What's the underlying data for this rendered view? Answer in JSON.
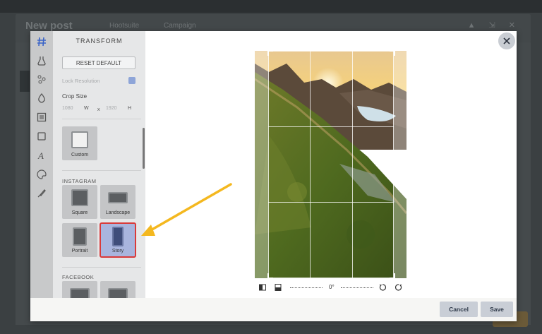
{
  "background": {
    "page_title": "New post",
    "menu_1": "Hootsuite",
    "menu_2": "Campaign"
  },
  "editor": {
    "panel_title": "TRANSFORM",
    "reset_label": "RESET DEFAULT",
    "lock_label": "Lock Resolution",
    "crop_size_label": "Crop Size",
    "width_value": "1080",
    "width_unit": "W",
    "times": "x",
    "height_value": "1920",
    "height_unit": "H",
    "custom_label": "Custom",
    "instagram_heading": "INSTAGRAM",
    "square_label": "Square",
    "landscape_label": "Landscape",
    "portrait_label": "Portrait",
    "story_label": "Story",
    "facebook_heading": "FACEBOOK",
    "rotation_value": "0°"
  },
  "footer": {
    "cancel_label": "Cancel",
    "save_label": "Save"
  },
  "colors": {
    "accent_highlight": "#a9b5de",
    "selection_outline": "#d93a3a",
    "arrow": "#f4b81f"
  }
}
